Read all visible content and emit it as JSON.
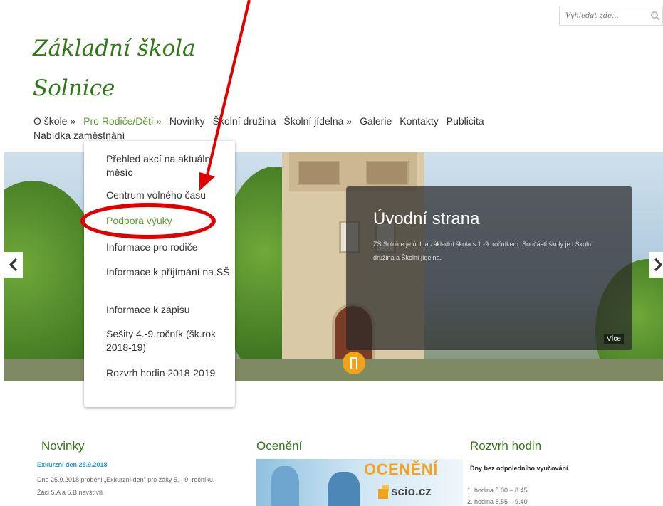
{
  "search": {
    "placeholder": "Vyhledat zde..."
  },
  "site": {
    "title_line1": "Základní škola",
    "title_line2": "Solnice"
  },
  "nav": {
    "items": [
      "O škole »",
      "Pro Rodiče/Děti »",
      "Novinky",
      "Školní družina",
      "Školní jídelna »",
      "Galerie",
      "Kontakty",
      "Publicita",
      "Nabídka zaměstnání"
    ]
  },
  "dropdown": {
    "items": [
      "Přehled akcí na aktuální měsíc",
      "Centrum volného času",
      "Podpora výuky",
      "Informace pro rodiče",
      "Informace k příjímání na SŠ",
      "Informace k zápisu",
      "Sešity 4.-9.ročník (šk.rok 2018-19)",
      "Rozvrh hodin 2018-2019"
    ]
  },
  "slider": {
    "caption_title": "Úvodní strana",
    "caption_text": "ZŠ Solnice je úplná základní škola s 1.-9. ročníkem. Součástí školy je i Školní družina a Školní jídelna.",
    "more_label": "Více"
  },
  "novinky": {
    "heading": "Novinky",
    "item_title": "Exkurzní den 25.9.2018",
    "item_text": "Dne 25.9.2018 proběhl „Exkurzní den\" pro žáky 5. - 9. ročníku. Žáci 5.A a 5.B navštívili"
  },
  "oceneni": {
    "heading": "Ocenění",
    "banner_word": "OCENĚNÍ",
    "banner_domain": "scio.cz"
  },
  "rozvrh": {
    "heading": "Rozvrh hodin",
    "subtitle": "Dny bez odpoledního vyučování",
    "lines": [
      "1. hodina 8.00 – 8.45",
      "2. hodina 8.55 – 9.40"
    ]
  },
  "colors": {
    "brand_green": "#2f7a14",
    "active_green": "#5a9e2a",
    "annotation_red": "#e10000",
    "link_blue": "#1d9bd8"
  }
}
